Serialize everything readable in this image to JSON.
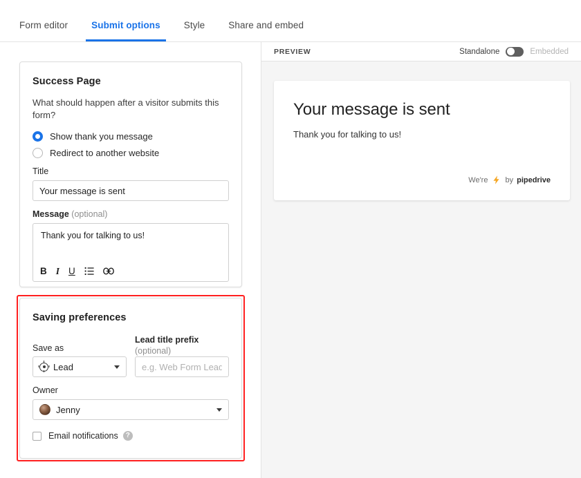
{
  "tabs": [
    {
      "label": "Form editor",
      "active": false
    },
    {
      "label": "Submit options",
      "active": true
    },
    {
      "label": "Style",
      "active": false
    },
    {
      "label": "Share and embed",
      "active": false
    }
  ],
  "success_page": {
    "title": "Success Page",
    "description": "What should happen after a visitor submits this form?",
    "options": [
      {
        "label": "Show thank you message",
        "selected": true
      },
      {
        "label": "Redirect to another website",
        "selected": false
      }
    ],
    "title_field": {
      "label": "Title",
      "value": "Your message is sent"
    },
    "message_field": {
      "label": "Message",
      "label_optional": "(optional)",
      "value": "Thank you for talking to us!"
    },
    "toolbar": [
      {
        "name": "bold-icon",
        "label": "B"
      },
      {
        "name": "italic-icon",
        "label": "I"
      },
      {
        "name": "underline-icon",
        "label": "U"
      },
      {
        "name": "bullet-list-icon",
        "label": "☰"
      },
      {
        "name": "link-icon",
        "label": "⚭"
      }
    ]
  },
  "saving_preferences": {
    "title": "Saving preferences",
    "save_as": {
      "label": "Save as",
      "value": "Lead",
      "icon": "target-icon"
    },
    "lead_title_prefix": {
      "label": "Lead title prefix",
      "label_optional": "(optional)",
      "value": "",
      "placeholder": "e.g. Web Form Lead"
    },
    "owner": {
      "label": "Owner",
      "value": "Jenny",
      "icon": "avatar"
    },
    "email_notifications": {
      "label": "Email notifications",
      "checked": false,
      "help_icon": "?"
    },
    "highlight_color": "#ff1f1f"
  },
  "preview": {
    "label": "PREVIEW",
    "mode_left": "Standalone",
    "mode_right": "Embedded",
    "toggle_on": false,
    "card": {
      "title": "Your message is sent",
      "body": "Thank you for talking to us!",
      "footer_prefix": "We're",
      "footer_middle": "by",
      "footer_brand": "pipedrive",
      "bolt_color": "#f5a623"
    }
  },
  "colors": {
    "accent": "#1a73e8",
    "highlight": "#ff1f1f",
    "preview_bg": "#f5f5f5"
  }
}
